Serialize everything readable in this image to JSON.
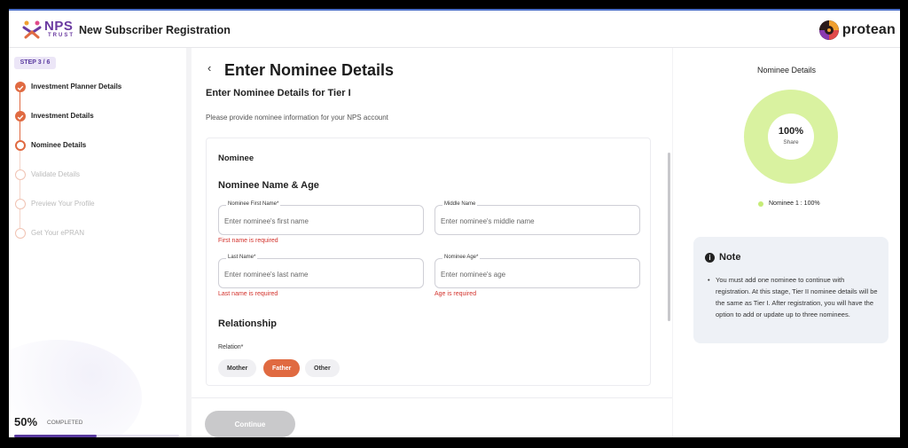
{
  "header": {
    "logo_text": "NPS",
    "logo_subtext": "TRUST",
    "title": "New Subscriber Registration",
    "brand": "protean"
  },
  "sidebar": {
    "step_badge": "STEP 3 / 6",
    "steps": [
      {
        "label": "Investment Planner Details",
        "state": "done"
      },
      {
        "label": "Investment Details",
        "state": "done"
      },
      {
        "label": "Nominee Details",
        "state": "active"
      },
      {
        "label": "Validate Details",
        "state": "todo"
      },
      {
        "label": "Preview Your Profile",
        "state": "todo"
      },
      {
        "label": "Get Your ePRAN",
        "state": "todo"
      }
    ],
    "progress_percent": "50%",
    "progress_value": 0.5,
    "progress_label": "COMPLETED"
  },
  "main": {
    "back_icon": "chevron-left-icon",
    "title": "Enter Nominee Details",
    "subtitle": "Enter Nominee Details for Tier I",
    "description": "Please provide nominee information for your NPS account",
    "card_heading": "Nominee",
    "section_name": "Nominee Name & Age",
    "fields": {
      "first_name": {
        "label": "Nominee First Name*",
        "placeholder": "Enter nominee's first name",
        "value": "",
        "error": "First name is required"
      },
      "middle_name": {
        "label": "Middle Name",
        "placeholder": "Enter nominee's middle name",
        "value": ""
      },
      "last_name": {
        "label": "Last Name*",
        "placeholder": "Enter nominee's last name",
        "value": "",
        "error": "Last name is required"
      },
      "age": {
        "label": "Nominee Age*",
        "placeholder": "Enter nominee's age",
        "value": "",
        "error": "Age is required"
      }
    },
    "relationship": {
      "section": "Relationship",
      "label": "Relation*",
      "options": [
        "Mother",
        "Father",
        "Other"
      ],
      "selected": "Father"
    },
    "continue_label": "Continue"
  },
  "right": {
    "title": "Nominee Details",
    "donut_percent": "100%",
    "donut_label": "Share",
    "legend": "Nominee 1 : 100%",
    "note_title": "Note",
    "note_icon": "info-icon",
    "note_text": "You must add one nominee to continue with registration. At this stage, Tier II nominee details will be the same as Tier I. After registration, you will have the option to add or update up to three nominees."
  },
  "colors": {
    "accent": "#e06a41",
    "brand_purple": "#5a3aa0",
    "donut": "#d9f2a0",
    "error": "#d3322c"
  }
}
